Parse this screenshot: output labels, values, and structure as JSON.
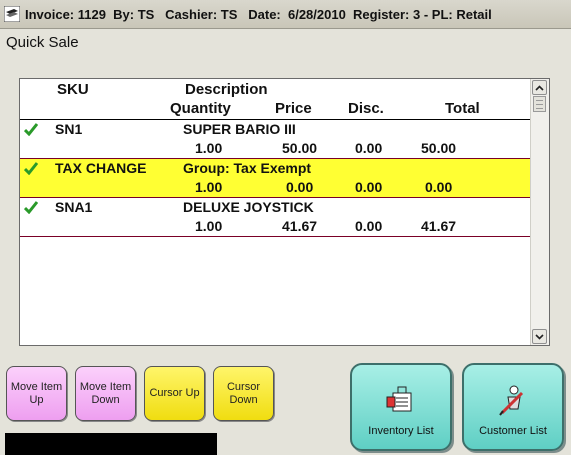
{
  "titlebar": {
    "title": "Invoice: 1129  By: TS   Cashier: TS   Date:  6/28/2010  Register: 3 - PL: Retail"
  },
  "window_label": "Quick Sale",
  "grid": {
    "headers": {
      "sku": "SKU",
      "description": "Description",
      "quantity": "Quantity",
      "price": "Price",
      "disc": "Disc.",
      "total": "Total"
    },
    "rows": [
      {
        "sku": "SN1",
        "description": "SUPER BARIO III",
        "quantity": "1.00",
        "price": "50.00",
        "disc": "0.00",
        "total": "50.00",
        "checked": true,
        "highlight": false
      },
      {
        "sku": "TAX CHANGE",
        "description": "Group: Tax Exempt",
        "quantity": "1.00",
        "price": "0.00",
        "disc": "0.00",
        "total": "0.00",
        "checked": true,
        "highlight": true
      },
      {
        "sku": "SNA1",
        "description": "DELUXE JOYSTICK",
        "quantity": "1.00",
        "price": "41.67",
        "disc": "0.00",
        "total": "41.67",
        "checked": true,
        "highlight": false
      }
    ]
  },
  "buttons": {
    "move_item_up": "Move Item Up",
    "move_item_down": "Move Item Down",
    "cursor_up": "Cursor Up",
    "cursor_down": "Cursor Down",
    "inventory_list": "Inventory List",
    "customer_list": "Customer List"
  },
  "colors": {
    "highlight_row": "#ffff33",
    "pink_button": "#f4b7f5",
    "yellow_button": "#f7e93a",
    "teal_button": "#7fded3",
    "check": "#2a9a2a"
  }
}
